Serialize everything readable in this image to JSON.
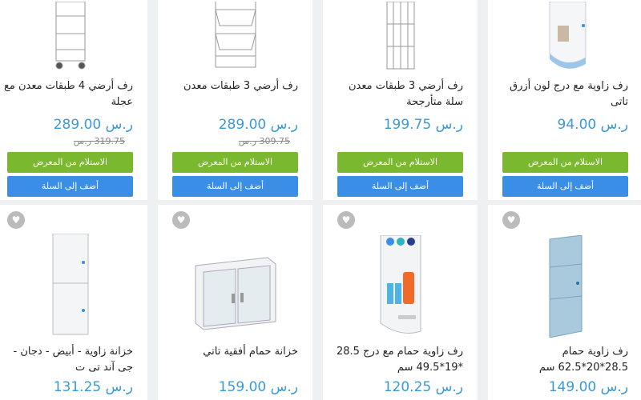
{
  "currency": "ر.س",
  "pick_label": "الاستلام من المعرض",
  "add_label": "أضف إلى السلة",
  "row1": [
    {
      "title": "رف زاوية مع درج لون أزرق تاتى",
      "price": "94.00",
      "old_price": ""
    },
    {
      "title": "رف أرضي 3 طبقات معدن سلة متأرجحة",
      "price": "199.75",
      "old_price": ""
    },
    {
      "title": "رف أرضي 3 طبقات معدن",
      "price": "289.00",
      "old_price": "309.75 ر.س"
    },
    {
      "title": "رف أرضي 4 طبقات معدن مع عجلة",
      "price": "289.00",
      "old_price": "319.75 ر.س"
    }
  ],
  "row2": [
    {
      "title": "رف زاوية حمام 28.5*20*62.5 سم",
      "price": "149.00"
    },
    {
      "title": "رف زاوية حمام مع درج 28.5 *19*49.5 سم",
      "price": "120.25"
    },
    {
      "title": "خزانة حمام أفقية تاتي",
      "price": "159.00"
    },
    {
      "title": "خزانة زاوية - أبيض - دجان - جى آند تى ت",
      "price": "131.25"
    }
  ]
}
